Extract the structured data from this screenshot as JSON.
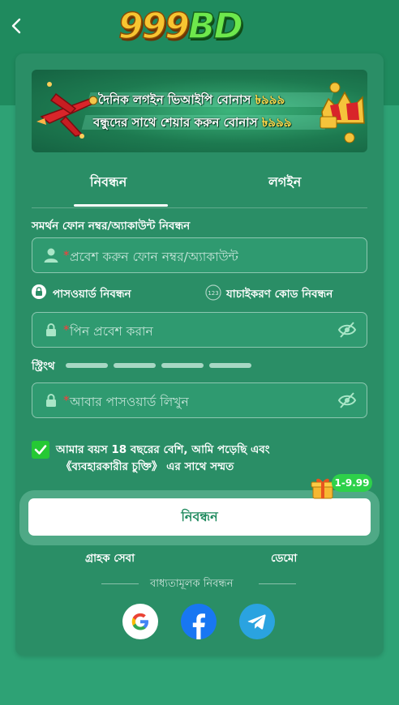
{
  "header": {
    "logo_nine": "999",
    "logo_bd": "BD"
  },
  "banner": {
    "line1_text": "দৈনিক লগইন ভিআইপি বোনাস ",
    "line1_amount": "৳৯৯৯",
    "line2_text": "বন্ধুদের সাথে শেয়ার করুন বোনাস ",
    "line2_amount": "৳৯৯৯"
  },
  "tabs": [
    {
      "label": "নিবন্ধন",
      "active": true
    },
    {
      "label": "লগইন",
      "active": false
    }
  ],
  "form": {
    "phone_label": "সমর্থন ফোন নম্বর/অ্যাকাউন্ট নিবন্ধন",
    "phone_placeholder": "প্রবেশ করুন ফোন নম্বর/অ্যাকাউন্ট",
    "password_register_option": "পাসওয়ার্ড নিবন্ধন",
    "code_register_option": "যাচাইকরণ কোড নিবন্ধন",
    "code_icon_text": "123",
    "pin_placeholder": "পিন প্রবেশ করান",
    "strength_label": "স্ট্রিংথ",
    "confirm_placeholder": "আবার পাসওয়ার্ড লিখুন",
    "agree_line1": "আমার বয়স 18 বছরের বেশি, আমি পড়েছি এবং",
    "agree_line2": "《ব্যবহারকারীর চুক্তি》 এর সাথে সম্মত",
    "agree_checked": true,
    "submit_label": "নিবন্ধন",
    "promo_badge": "1-9.99"
  },
  "footer": {
    "customer_service": "গ্রাহক সেবা",
    "demo": "ডেমো",
    "mandatory_register": "বাধ্যতামূলক নিবন্ধন"
  },
  "colors": {
    "background": "#2ea275",
    "card": "#2a8e66",
    "checkbox": "#25c934",
    "button_text": "#1f8a5e",
    "required_star": "#ff3b3b"
  },
  "icons": [
    "back-arrow-icon",
    "user-icon",
    "lock-icon",
    "eye-off-icon",
    "google-icon",
    "facebook-icon",
    "telegram-icon",
    "gift-icon",
    "check-icon"
  ]
}
